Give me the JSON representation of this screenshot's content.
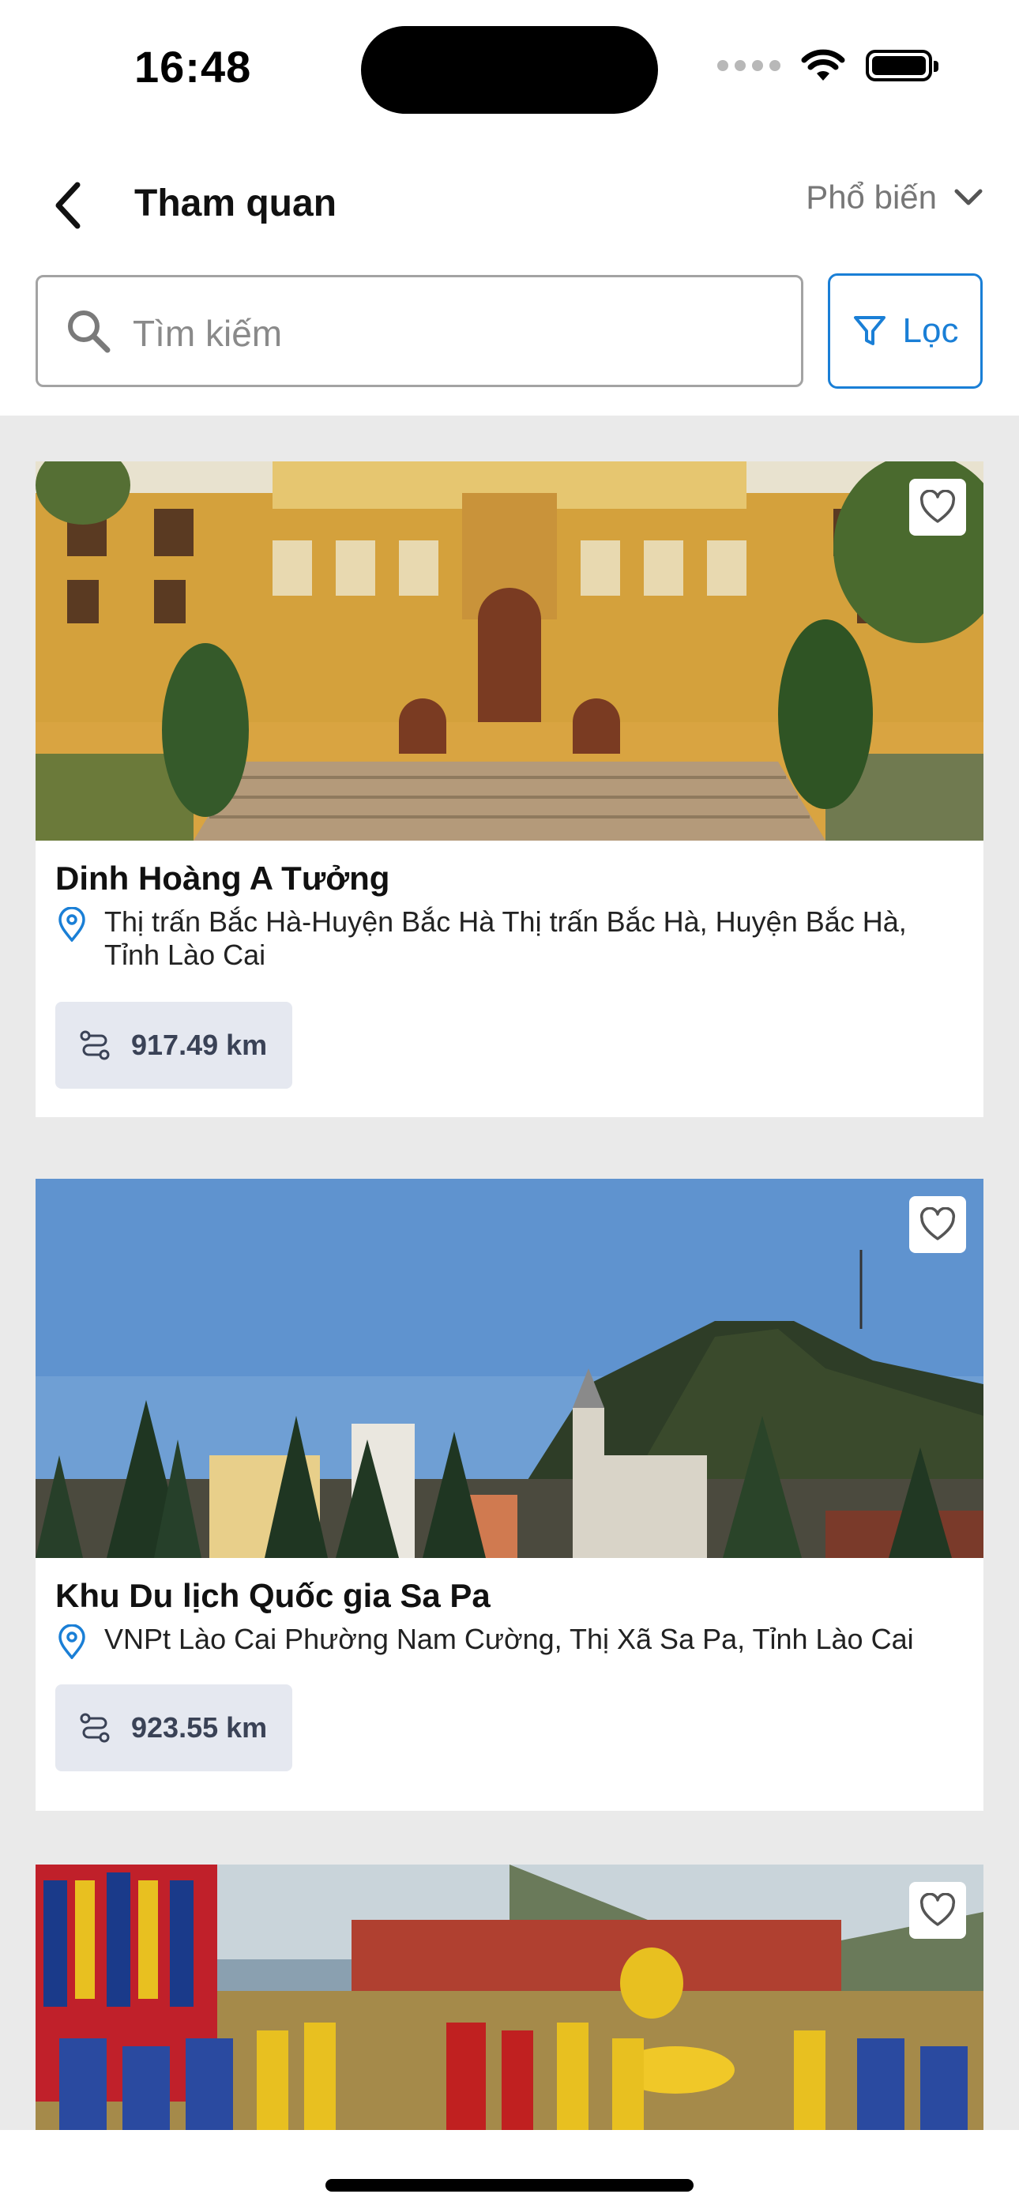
{
  "status_bar": {
    "time": "16:48"
  },
  "header": {
    "title": "Tham quan",
    "sort_label": "Phổ biến"
  },
  "search": {
    "placeholder": "Tìm kiếm"
  },
  "filter": {
    "label": "Lọc",
    "accent": "#1a7fd6"
  },
  "places": [
    {
      "name": "Dinh Hoàng A Tưởng",
      "address": "Thị trấn Bắc Hà-Huyện Bắc Hà  Thị trấn Bắc Hà, Huyện Bắc Hà, Tỉnh Lào Cai",
      "distance": "917.49 km"
    },
    {
      "name": "Khu Du lịch Quốc gia Sa Pa",
      "address": "VNPt Lào Cai  Phường Nam Cường, Thị Xã Sa Pa, Tỉnh Lào Cai",
      "distance": "923.55 km"
    },
    {
      "name": "",
      "address": "",
      "distance": ""
    }
  ]
}
